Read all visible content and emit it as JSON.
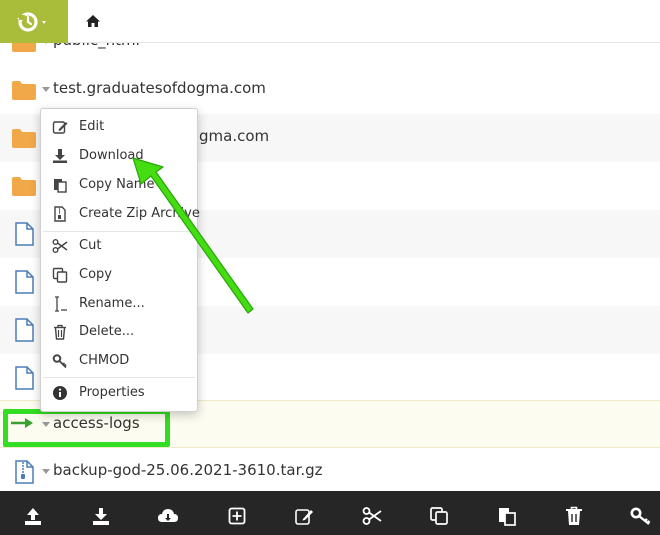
{
  "files": [
    {
      "name": "public_html",
      "type": "folder"
    },
    {
      "name": "test.graduatesofdogma.com",
      "type": "folder"
    },
    {
      "name": "gma.com",
      "type": "folder"
    },
    {
      "name": "",
      "type": "folder"
    },
    {
      "name": "",
      "type": "file"
    },
    {
      "name": "",
      "type": "file"
    },
    {
      "name": "",
      "type": "file"
    },
    {
      "name": "",
      "type": "file"
    },
    {
      "name": "access-logs",
      "type": "link"
    },
    {
      "name": "backup-god-25.06.2021-3610.tar.gz",
      "type": "archive"
    }
  ],
  "context_menu": {
    "items": [
      {
        "label": "Edit",
        "icon": "edit-icon"
      },
      {
        "label": "Download",
        "icon": "download-icon"
      },
      {
        "label": "Copy Name",
        "icon": "copy-name-icon"
      },
      {
        "label": "Create Zip Archive",
        "icon": "zip-icon"
      },
      {
        "label": "Cut",
        "icon": "scissors-icon"
      },
      {
        "label": "Copy",
        "icon": "copy-icon"
      },
      {
        "label": "Rename...",
        "icon": "rename-icon"
      },
      {
        "label": "Delete...",
        "icon": "trash-icon"
      },
      {
        "label": "CHMOD",
        "icon": "key-icon"
      },
      {
        "label": "Properties",
        "icon": "info-icon"
      }
    ]
  },
  "toolbar": {
    "buttons": [
      "upload-icon",
      "download-icon",
      "cloud-download-icon",
      "new-item-icon",
      "edit-icon",
      "scissors-icon",
      "copy-icon",
      "paste-icon",
      "trash-icon",
      "key-icon"
    ]
  },
  "colors": {
    "brand": "#aabd3a",
    "folder": "#f0a848",
    "file_outline": "#4a7fb5",
    "annotation": "#33dd22",
    "toolbar_bg": "#262626"
  }
}
